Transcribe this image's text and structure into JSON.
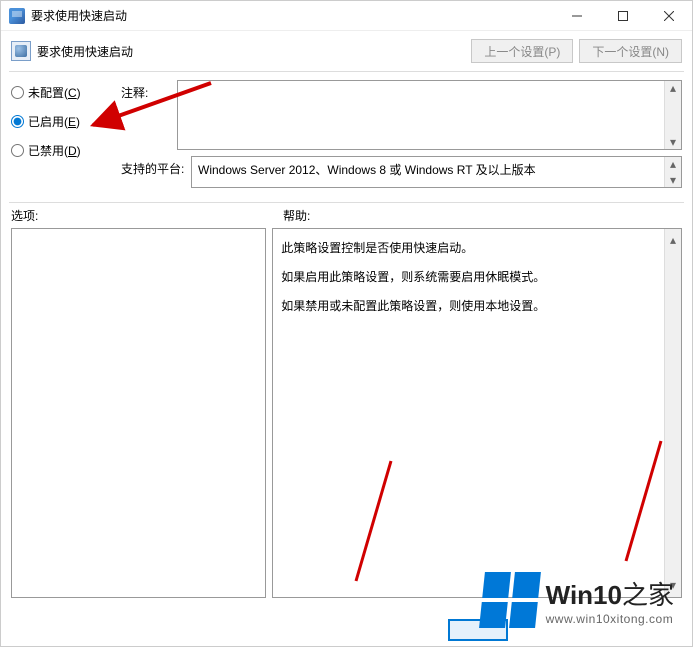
{
  "titlebar": {
    "title": "要求使用快速启动"
  },
  "header": {
    "policy_name": "要求使用快速启动",
    "prev_btn": "上一个设置(P)",
    "next_btn": "下一个设置(N)"
  },
  "radios": {
    "not_configured": "未配置(C)",
    "enabled": "已启用(E)",
    "disabled": "已禁用(D)",
    "selected": "enabled"
  },
  "fields": {
    "comment_label": "注释:",
    "comment_value": "",
    "platform_label": "支持的平台:",
    "platform_value": "Windows Server 2012、Windows 8 或 Windows RT 及以上版本"
  },
  "panes": {
    "options_label": "选项:",
    "help_label": "帮助:",
    "help_lines": [
      "此策略设置控制是否使用快速启动。",
      "如果启用此策略设置，则系统需要启用休眠模式。",
      "如果禁用或未配置此策略设置，则使用本地设置。"
    ]
  },
  "watermark": {
    "brand": "Win10",
    "suffix": "之家",
    "url": "www.win10xitong.com"
  }
}
